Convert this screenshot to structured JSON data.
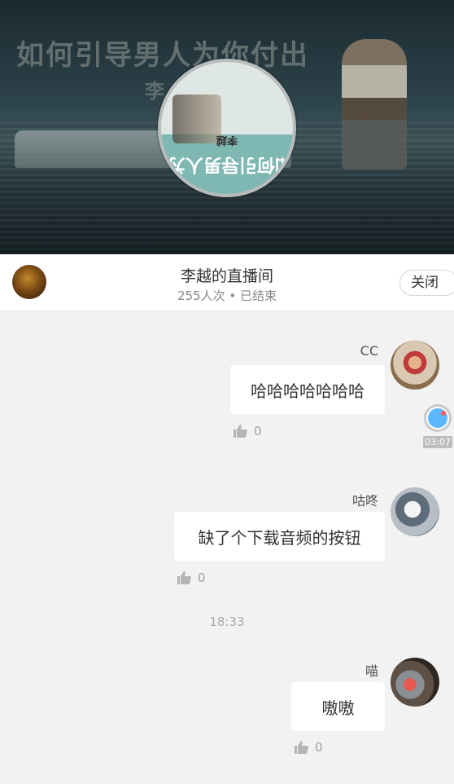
{
  "cover": {
    "overlay_title": "如何引导男人为你付出",
    "overlay_sub": "李",
    "disc_text": "如何引导男人为你付出",
    "disc_sub": "李越"
  },
  "room": {
    "title": "李越的直播间",
    "meta": "255人次 • 已结束",
    "close_label": "关闭"
  },
  "messages": [
    {
      "name": "CC",
      "text": "哈哈哈哈哈哈哈",
      "likes": "0"
    },
    {
      "name": "咕咚",
      "text": "缺了个下载音频的按钮",
      "likes": "0"
    },
    {
      "name": "喵",
      "text": "嗷嗷",
      "likes": "0"
    }
  ],
  "audio": {
    "duration": "03:07"
  },
  "timestamp": "18:33",
  "colors": {
    "background": "#f2f2f2",
    "bubble": "#ffffff",
    "audio_accent": "#5bb7ff"
  }
}
